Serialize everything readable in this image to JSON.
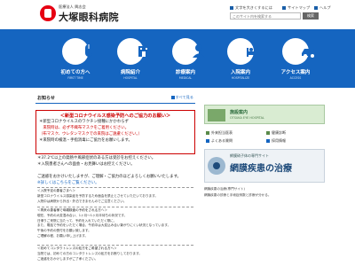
{
  "header": {
    "logo_sub": "医療法人 興志会",
    "logo_name": "大塚眼科病院",
    "util_links": [
      "文字を大きくするには",
      "サイトマップ",
      "ヘルプ"
    ],
    "search_placeholder": "このサイト内を検索する",
    "search_button": "検索"
  },
  "nav": {
    "items": [
      {
        "label": "初めての方へ",
        "sub": "FIRST TIME",
        "icon": "mouse-icon"
      },
      {
        "label": "病院紹介",
        "sub": "HOSPITAL",
        "icon": "building-icon"
      },
      {
        "label": "診療案内",
        "sub": "MEDICAL",
        "icon": "doctor-icon"
      },
      {
        "label": "入院案内",
        "sub": "HOSPITALIZE",
        "icon": "bed-icon"
      },
      {
        "label": "アクセス案内",
        "sub": "ACCESS",
        "icon": "car-icon"
      }
    ]
  },
  "news": {
    "title": "お知らせ",
    "more": "すべて見る"
  },
  "notice": {
    "title": "＜新型コロナウイルス感染予防へのご協力のお願い＞",
    "lines": [
      "＊新型コロナウイルスのワクチン接種にかかわらず",
      "　来院時は、必ず不織布マスクをご着用ください。",
      "（布マスク、ウレタンマスクでの来院はご遠慮ください。）",
      "＊来院時の検温・手指消毒にご協力をお願いします。",
      "＊37.2℃以上の発熱や風邪症状のある方は受診をお控えください。",
      "＊入院患者さんへの面会・お見舞いはお控えください。"
    ]
  },
  "after_notice": [
    "ご迷惑をおかけいたしますが、ご理解・ご協力のほどよろしくお願いいたします。",
    "※詳しくはこちらをご覧ください。"
  ],
  "box1": {
    "heading": "＜入院予定の患者さまへ＞",
    "lines": [
      "新型コロナウイルス感染症を予防するため面会を禁止とさせていただいております。",
      "入院中は病院から外出・外泊できませんのでご注意ください。"
    ]
  },
  "box2": {
    "heading": "＜再来の患者様で母親検査の予約をされる方へ＞",
    "lines": [
      "現在、予約の大変混み合い、1ヶ月～1ヶ月半待ちの状況です。",
      "日帰りご来院に当たって、予約を入れていただく際に、",
      "また、電話で予約をいただく場合、午前中は大変込み合い繋がりにくい状況となっています。",
      "午後の予約の受付をお願い致します。",
      "ご理解の程、お願い申し上げます。"
    ]
  },
  "box3": {
    "heading": "＜初めてコンタクトレンズの処方をご希望される方へ＞",
    "lines": [
      "当院では、初めての方のコンタクトレンズの処方をお断りしております。",
      "ご迷惑をおかけしますがご了承ください。"
    ]
  },
  "side": {
    "banner1_title": "施設案内",
    "banner1_sub": "OTSUKA EYE HOSPITAL",
    "links": [
      {
        "label": "外来担当医表",
        "style": "green"
      },
      {
        "label": "健康診断",
        "style": "green"
      },
      {
        "label": "よくある質問",
        "style": "blue"
      },
      {
        "label": "採用情報",
        "style": "blue"
      }
    ],
    "banner2_top": "網膜硝子体の専門サイト",
    "banner2_big": "網膜疾患の治療",
    "caption1": "網膜疾患の治療(専門サイト)",
    "caption2": "網膜疾患の診療と手術症例数と診療が分かる。"
  },
  "colors": {
    "brand_blue": "#1565c0",
    "alert_red": "#cc0000"
  }
}
